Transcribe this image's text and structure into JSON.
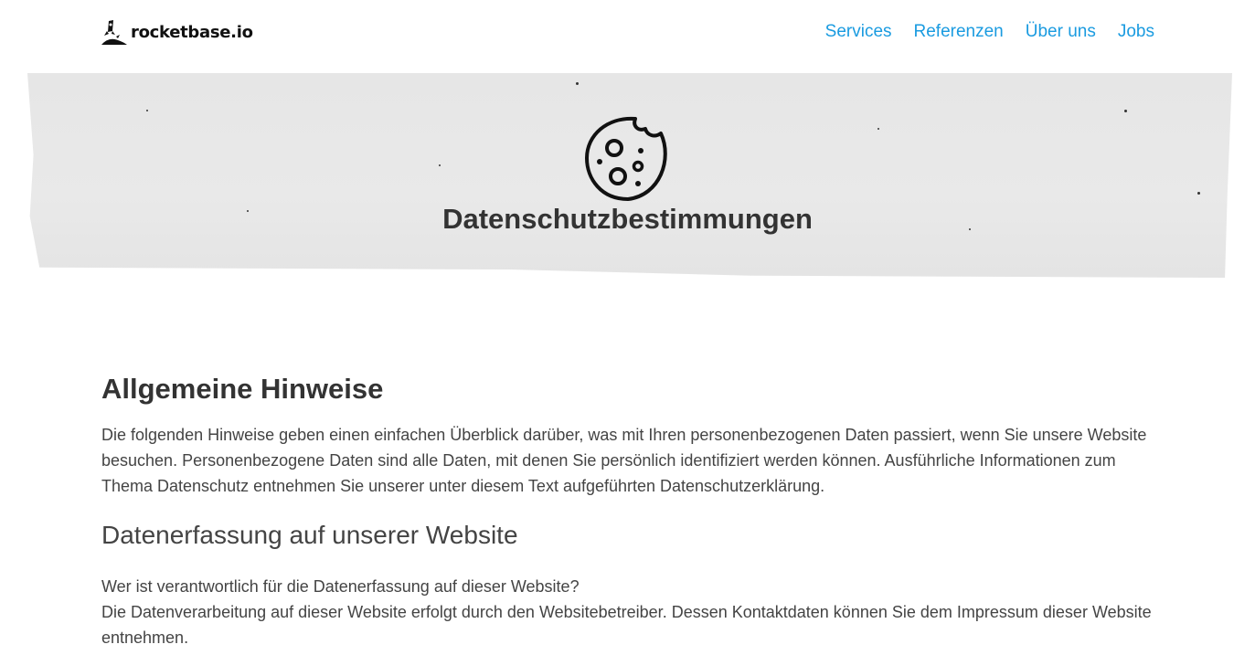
{
  "header": {
    "logo_text": "rocketbase.io",
    "nav": [
      "Services",
      "Referenzen",
      "Über uns",
      "Jobs"
    ]
  },
  "hero": {
    "icon": "cookie-icon",
    "title": "Datenschutzbestimmungen"
  },
  "content": {
    "heading": "Allgemeine Hinweise",
    "intro": "Die folgenden Hinweise geben einen einfachen Überblick darüber, was mit Ihren personenbezogenen Daten passiert, wenn Sie unsere Website besuchen. Personenbezogene Daten sind alle Daten, mit denen Sie persönlich identifiziert werden können. Ausführliche Informationen zum Thema Datenschutz entnehmen Sie unserer unter diesem Text aufgeführten Datenschutzerklärung.",
    "subheading": "Datenerfassung auf unserer Website",
    "question": "Wer ist verantwortlich für die Datenerfassung auf dieser Website?",
    "answer": "Die Datenverarbeitung auf dieser Website erfolgt durch den Websitebetreiber. Dessen Kontaktdaten können Sie dem Impressum dieser Website entnehmen."
  },
  "colors": {
    "link": "#1a9be0",
    "text": "#3a3a3a"
  }
}
